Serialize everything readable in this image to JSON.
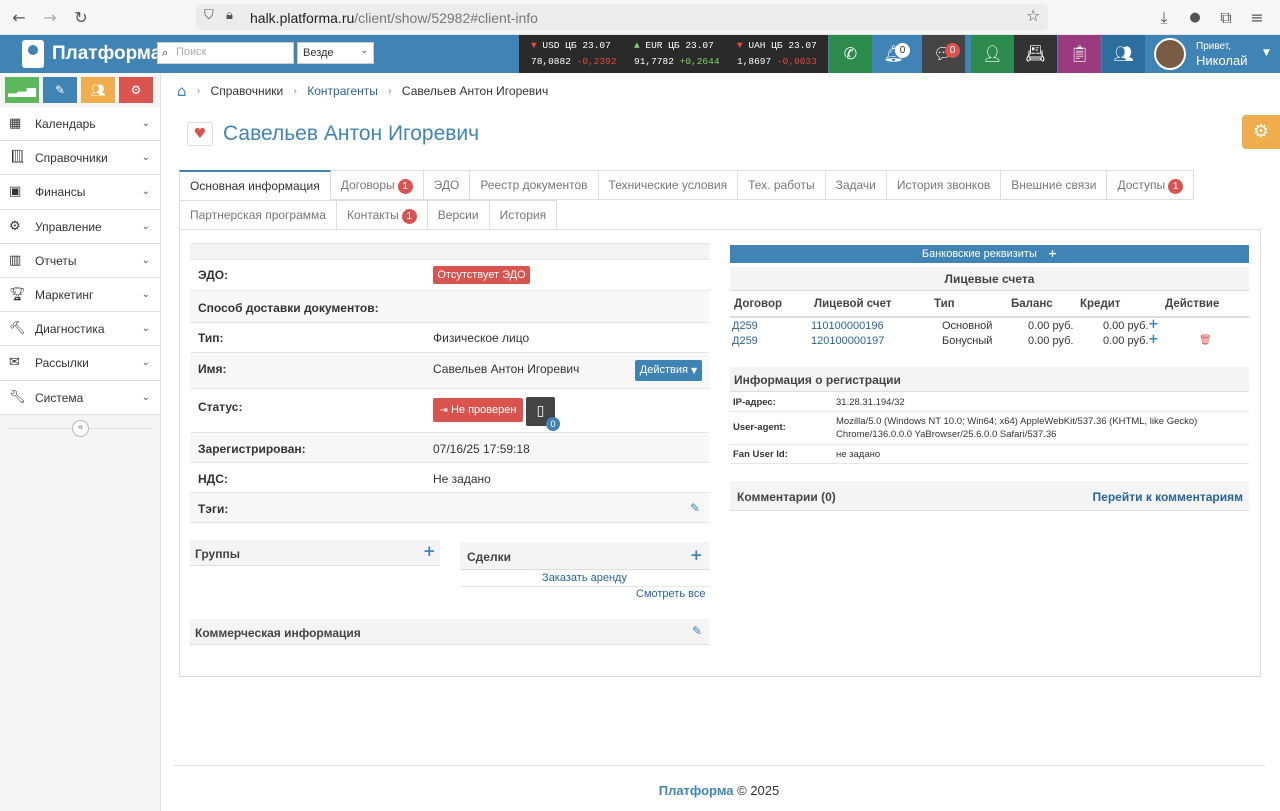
{
  "browser": {
    "url_host": "halk.platforma.ru",
    "url_path": "/client/show/52982#client-info"
  },
  "header": {
    "brand": "Платформа",
    "search_placeholder": "Поиск",
    "scope_value": "Везде",
    "rates": [
      {
        "arrow": "▼",
        "code": "USD ЦБ 23.07",
        "value": "78,0882",
        "change": "-0,2392",
        "dir": "down"
      },
      {
        "arrow": "▲",
        "code": "EUR ЦБ 23.07",
        "value": "91,7782",
        "change": "+0,2644",
        "dir": "up"
      },
      {
        "arrow": "▼",
        "code": "UAH ЦБ 23.07",
        "value": "1,8697",
        "change": "-0,0033",
        "dir": "down"
      }
    ],
    "notifications_count": "0",
    "messages_count": "0",
    "user_greeting": "Привет,",
    "user_name": "Николай"
  },
  "sidebar": {
    "items": [
      {
        "label": "Календарь"
      },
      {
        "label": "Справочники"
      },
      {
        "label": "Финансы"
      },
      {
        "label": "Управление"
      },
      {
        "label": "Отчеты"
      },
      {
        "label": "Маркетинг"
      },
      {
        "label": "Диагностика"
      },
      {
        "label": "Рассылки"
      },
      {
        "label": "Система"
      }
    ]
  },
  "breadcrumb": {
    "item1": "Справочники",
    "item2": "Контрагенты",
    "current": "Савельев Антон Игоревич"
  },
  "page": {
    "title": "Савельев Антон Игоревич"
  },
  "tabs": {
    "row1": [
      {
        "label": "Основная информация",
        "badge": ""
      },
      {
        "label": "Договоры",
        "badge": "1"
      },
      {
        "label": "ЭДО",
        "badge": ""
      },
      {
        "label": "Реестр документов",
        "badge": ""
      },
      {
        "label": "Технические условия",
        "badge": ""
      },
      {
        "label": "Тех. работы",
        "badge": ""
      },
      {
        "label": "Задачи",
        "badge": ""
      },
      {
        "label": "История звонков",
        "badge": ""
      },
      {
        "label": "Внешние связи",
        "badge": ""
      },
      {
        "label": "Доступы",
        "badge": "1"
      }
    ],
    "row2": [
      {
        "label": "Партнерская программа",
        "badge": ""
      },
      {
        "label": "Контакты",
        "badge": "1"
      },
      {
        "label": "Версии",
        "badge": ""
      },
      {
        "label": "История",
        "badge": ""
      }
    ]
  },
  "info": {
    "edo_label": "ЭДО:",
    "edo_value": "Отсутствует ЭДО",
    "delivery_label": "Способ доставки документов:",
    "type_label": "Тип:",
    "type_value": "Физическое лицо",
    "name_label": "Имя:",
    "name_value": "Савельев Антон Игоревич",
    "actions_label": "Действия",
    "status_label": "Статус:",
    "status_value": "Не проверен",
    "docs_count": "0",
    "registered_label": "Зарегистрирован:",
    "registered_value": "07/16/25 17:59:18",
    "vat_label": "НДС:",
    "vat_value": "Не задано",
    "tags_label": "Тэги:"
  },
  "groups": {
    "title": "Группы"
  },
  "deals": {
    "title": "Сделки",
    "order_link": "Заказать аренду",
    "view_all": "Смотреть все"
  },
  "commercial": {
    "title": "Коммерческая информация"
  },
  "bank": {
    "title": "Банковские реквизиты"
  },
  "accounts": {
    "title": "Лицевые счета",
    "headers": [
      "Договор",
      "Лицевой счет",
      "Тип",
      "Баланс",
      "Кредит",
      "Действие"
    ],
    "rows": [
      {
        "contract": "Д259",
        "account": "110100000196",
        "type": "Основной",
        "balance": "0.00 руб.",
        "credit": "0.00 руб."
      },
      {
        "contract": "Д259",
        "account": "120100000197",
        "type": "Бонусный",
        "balance": "0.00 руб.",
        "credit": "0.00 руб."
      }
    ]
  },
  "registration": {
    "title": "Информация о регистрации",
    "ip_label": "IP-адрес:",
    "ip_value": "31.28.31.194/32",
    "ua_label": "User-agent:",
    "ua_value": "Mozilla/5.0 (Windows NT 10.0; Win64; x64) AppleWebKit/537.36 (KHTML, like Gecko) Chrome/136.0.0.0 YaBrowser/25.6.0.0 Safari/537.36",
    "fan_label": "Fan User Id:",
    "fan_value": "не задано"
  },
  "comments": {
    "title": "Комментарии (0)",
    "link": "Перейти к комментариям"
  },
  "footer": {
    "brand": "Платформа",
    "copy": "© 2025"
  }
}
